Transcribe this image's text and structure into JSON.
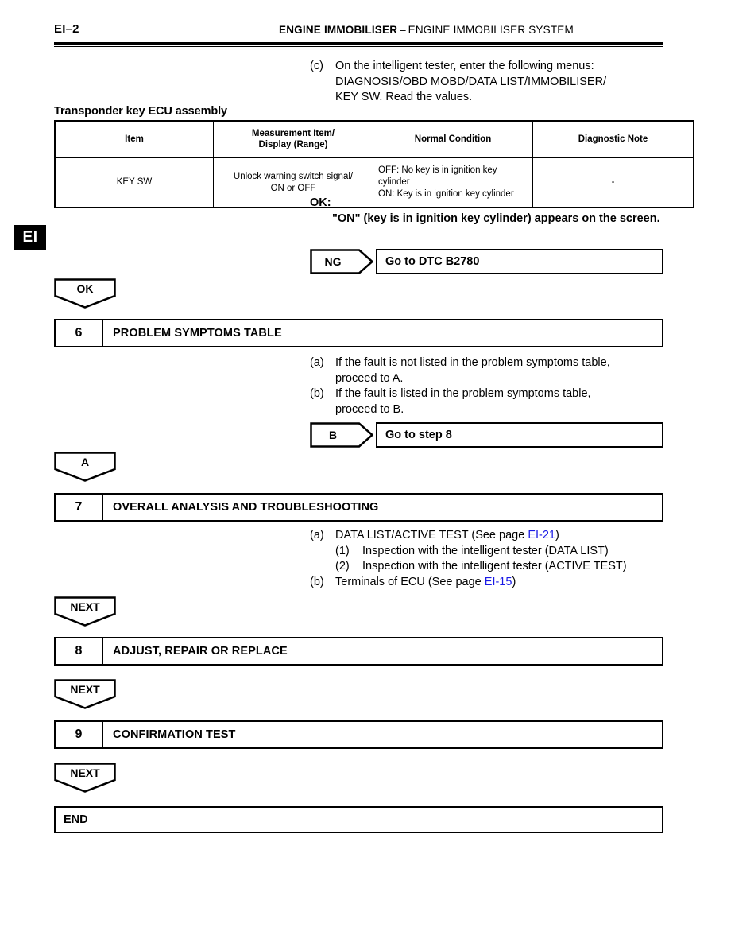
{
  "header": {
    "page_number": "EI–2",
    "title_bold": "ENGINE IMMOBILISER",
    "title_dash": "–",
    "title_rest": "ENGINE IMMOBILISER SYSTEM",
    "section_tab": "EI"
  },
  "step5_continued": {
    "label": "(c)",
    "line1": "On the intelligent tester, enter the following menus:",
    "line2": "DIAGNOSIS/OBD MOBD/DATA LIST/IMMOBILISER/",
    "line3": "KEY SW. Read the values."
  },
  "data_table": {
    "caption": "Transponder key ECU assembly",
    "headers": [
      "Item",
      "Measurement Item/\nDisplay (Range)",
      "Normal Condition",
      "Diagnostic Note"
    ],
    "header_meas_line1": "Measurement Item/",
    "header_meas_line2": "Display (Range)",
    "rows": [
      {
        "item": "KEY SW",
        "measurement_line1": "Unlock warning switch signal/",
        "measurement_line2": "ON or OFF",
        "condition_line1": "OFF: No key is in ignition key",
        "condition_line2": "cylinder",
        "condition_line3": "ON: Key is in ignition key cylinder",
        "note": "-"
      }
    ]
  },
  "ok_result": {
    "title": "OK:",
    "text": "\"ON\" (key is in ignition key cylinder) appears on the screen."
  },
  "flow": {
    "ng_tag": "NG",
    "ng_action": "Go to DTC B2780",
    "ok_connector": "OK",
    "b_tag": "B",
    "b_action": "Go to step 8",
    "a_connector": "A",
    "next_connector": "NEXT"
  },
  "step6": {
    "number": "6",
    "title": "PROBLEM SYMPTOMS TABLE",
    "items": [
      {
        "label": "(a)",
        "line1": "If the fault is not listed in the problem symptoms table,",
        "line2": "proceed to A."
      },
      {
        "label": "(b)",
        "line1": "If the fault is listed in the problem symptoms table,",
        "line2": "proceed to B."
      }
    ]
  },
  "step7": {
    "number": "7",
    "title": "OVERALL ANALYSIS AND TROUBLESHOOTING",
    "item_a_label": "(a)",
    "item_a_text_before": "DATA LIST/ACTIVE TEST (See page ",
    "item_a_link": "EI-21",
    "item_a_text_after": ")",
    "sub1_label": "(1)",
    "sub1_text": "Inspection with the intelligent tester (DATA LIST)",
    "sub2_label": "(2)",
    "sub2_text": "Inspection with the intelligent tester (ACTIVE TEST)",
    "item_b_label": "(b)",
    "item_b_text_before": "Terminals of ECU (See page ",
    "item_b_link": "EI-15",
    "item_b_text_after": ")"
  },
  "step8": {
    "number": "8",
    "title": "ADJUST, REPAIR OR REPLACE"
  },
  "step9": {
    "number": "9",
    "title": "CONFIRMATION TEST"
  },
  "end_box": {
    "label": "END"
  }
}
